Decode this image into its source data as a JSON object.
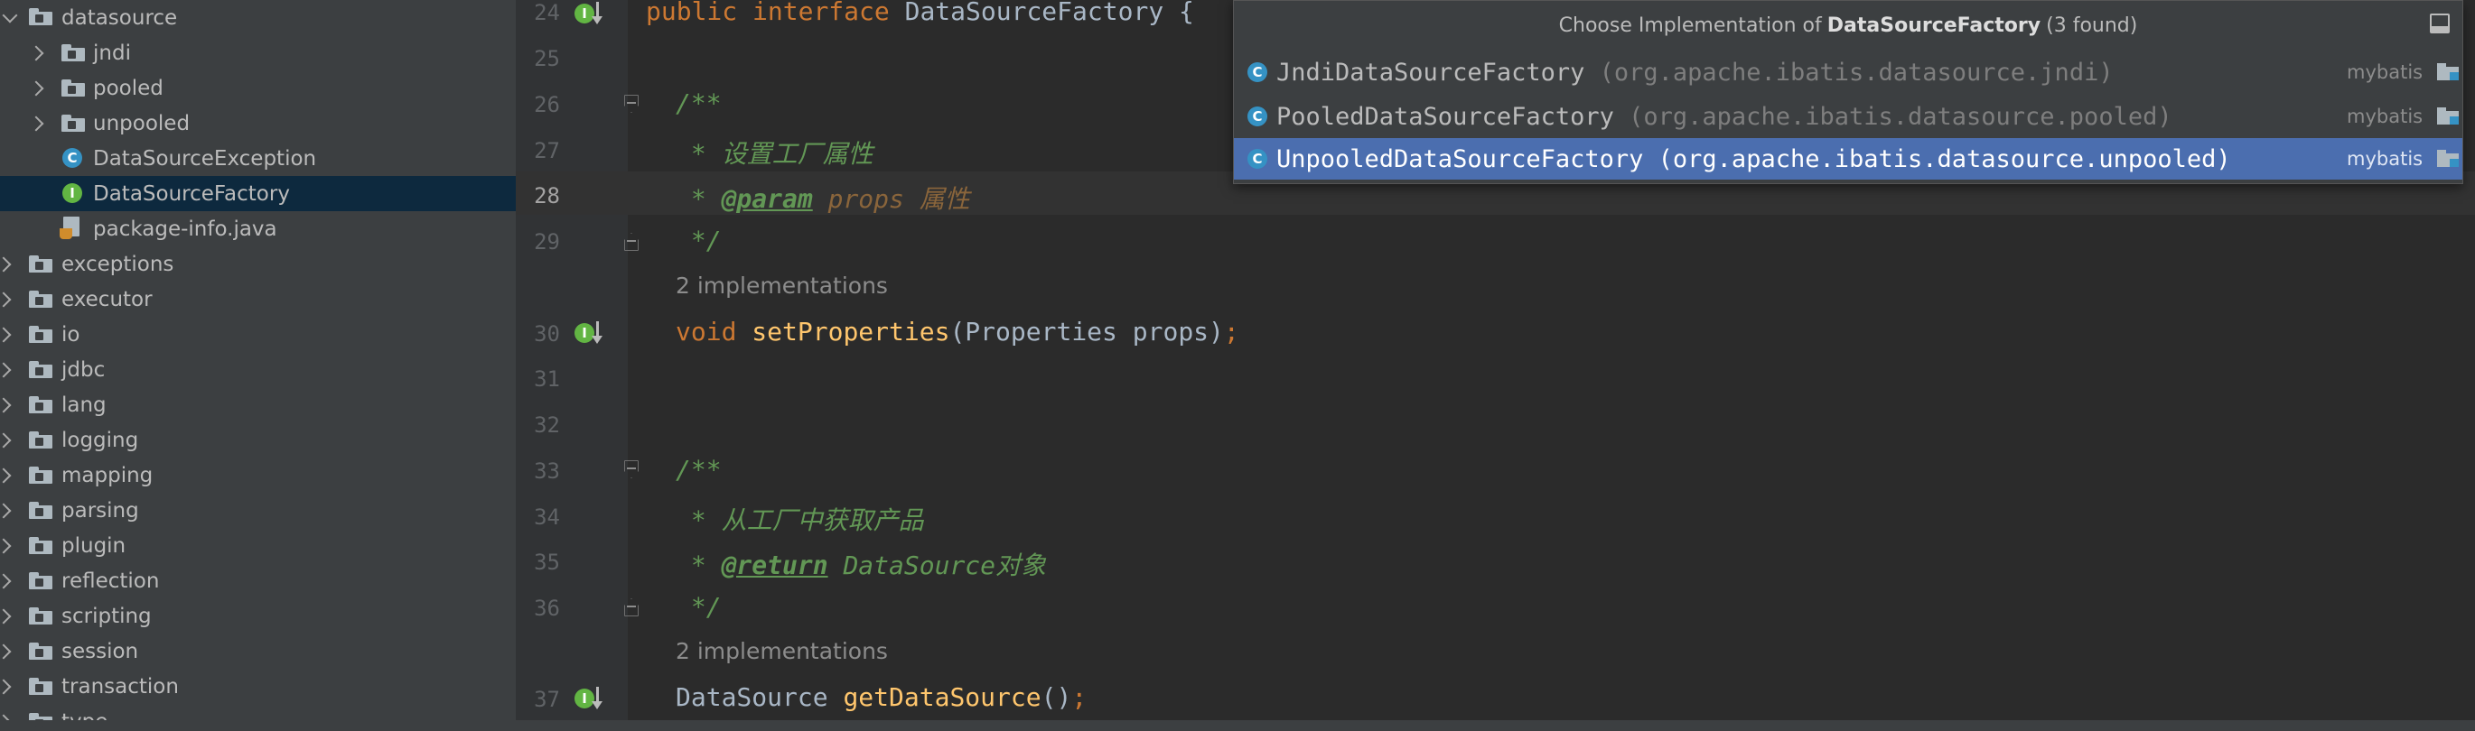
{
  "tree": {
    "items": [
      {
        "label": "datasource",
        "kind": "folder",
        "state": "expanded",
        "indent": 0
      },
      {
        "label": "jndi",
        "kind": "folder",
        "state": "collapsed",
        "indent": 1
      },
      {
        "label": "pooled",
        "kind": "folder",
        "state": "collapsed",
        "indent": 1
      },
      {
        "label": "unpooled",
        "kind": "folder",
        "state": "collapsed",
        "indent": 1
      },
      {
        "label": "DataSourceException",
        "kind": "class",
        "glyph": "C",
        "indent": 1
      },
      {
        "label": "DataSourceFactory",
        "kind": "interface",
        "glyph": "I",
        "indent": 1,
        "selected": true
      },
      {
        "label": "package-info.java",
        "kind": "java-file",
        "indent": 1
      },
      {
        "label": "exceptions",
        "kind": "folder",
        "state": "collapsed",
        "indent": 0
      },
      {
        "label": "executor",
        "kind": "folder",
        "state": "collapsed",
        "indent": 0
      },
      {
        "label": "io",
        "kind": "folder",
        "state": "collapsed",
        "indent": 0
      },
      {
        "label": "jdbc",
        "kind": "folder",
        "state": "collapsed",
        "indent": 0
      },
      {
        "label": "lang",
        "kind": "folder",
        "state": "collapsed",
        "indent": 0
      },
      {
        "label": "logging",
        "kind": "folder",
        "state": "collapsed",
        "indent": 0
      },
      {
        "label": "mapping",
        "kind": "folder",
        "state": "collapsed",
        "indent": 0
      },
      {
        "label": "parsing",
        "kind": "folder",
        "state": "collapsed",
        "indent": 0
      },
      {
        "label": "plugin",
        "kind": "folder",
        "state": "collapsed",
        "indent": 0
      },
      {
        "label": "reflection",
        "kind": "folder",
        "state": "collapsed",
        "indent": 0
      },
      {
        "label": "scripting",
        "kind": "folder",
        "state": "collapsed",
        "indent": 0
      },
      {
        "label": "session",
        "kind": "folder",
        "state": "collapsed",
        "indent": 0
      },
      {
        "label": "transaction",
        "kind": "folder",
        "state": "collapsed",
        "indent": 0
      },
      {
        "label": "type",
        "kind": "folder",
        "state": "collapsed",
        "indent": 0
      }
    ]
  },
  "editor": {
    "line_numbers": [
      "24",
      "25",
      "26",
      "27",
      "28",
      "29",
      "30",
      "31",
      "32",
      "33",
      "34",
      "35",
      "36",
      "37"
    ],
    "current_line": "28",
    "line24": {
      "kw1": "public",
      "kw2": "interface",
      "name": "DataSourceFactory",
      "brace": " {"
    },
    "line26": {
      "text": "/**"
    },
    "line27": {
      "text": " * 设置工厂属性"
    },
    "line28": {
      "star": " * ",
      "tag": "@param",
      "param": "props",
      "text": " 属性"
    },
    "line29": {
      "text": " */"
    },
    "hint1": "2 implementations",
    "line30": {
      "kw": "void",
      "fn": "setProperties",
      "args": "(Properties props)",
      "semi": ";"
    },
    "line33": {
      "text": "/**"
    },
    "line34": {
      "text": " * 从工厂中获取产品"
    },
    "line35": {
      "star": " * ",
      "tag": "@return",
      "text": " DataSource对象"
    },
    "line36": {
      "text": " */"
    },
    "hint2": "2 implementations",
    "line37": {
      "type": "DataSource ",
      "fn": "getDataSource",
      "args": "()",
      "semi": ";"
    }
  },
  "popup": {
    "title_prefix": "Choose Implementation of",
    "title_name": "DataSourceFactory",
    "title_suffix": "(3 found)",
    "items": [
      {
        "name": "JndiDataSourceFactory",
        "package": "(org.apache.ibatis.datasource.jndi)",
        "module": "mybatis",
        "glyph": "C"
      },
      {
        "name": "PooledDataSourceFactory",
        "package": "(org.apache.ibatis.datasource.pooled)",
        "module": "mybatis",
        "glyph": "C"
      },
      {
        "name": "UnpooledDataSourceFactory",
        "package": "(org.apache.ibatis.datasource.unpooled)",
        "module": "mybatis",
        "glyph": "C",
        "selected": true
      }
    ]
  },
  "colors": {
    "selection": "#4b6eaf",
    "tree_selection": "#0d293e",
    "keyword": "#cc7832",
    "function": "#ffc66d",
    "doc_comment": "#629755"
  }
}
